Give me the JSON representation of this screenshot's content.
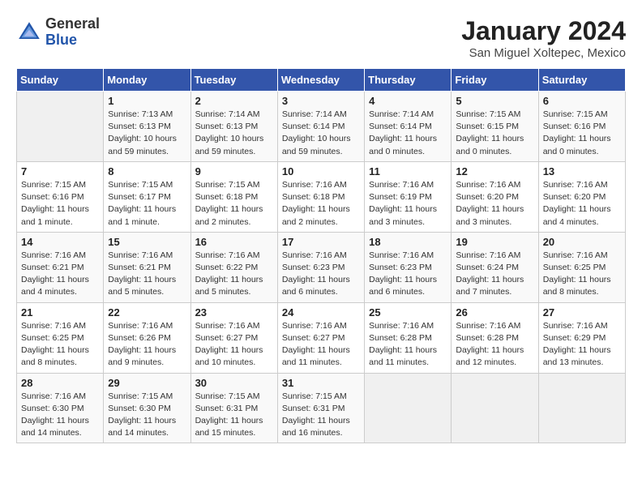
{
  "header": {
    "logo_line1": "General",
    "logo_line2": "Blue",
    "month_year": "January 2024",
    "location": "San Miguel Xoltepec, Mexico"
  },
  "days_of_week": [
    "Sunday",
    "Monday",
    "Tuesday",
    "Wednesday",
    "Thursday",
    "Friday",
    "Saturday"
  ],
  "weeks": [
    [
      {
        "day": "",
        "info": ""
      },
      {
        "day": "1",
        "info": "Sunrise: 7:13 AM\nSunset: 6:13 PM\nDaylight: 10 hours\nand 59 minutes."
      },
      {
        "day": "2",
        "info": "Sunrise: 7:14 AM\nSunset: 6:13 PM\nDaylight: 10 hours\nand 59 minutes."
      },
      {
        "day": "3",
        "info": "Sunrise: 7:14 AM\nSunset: 6:14 PM\nDaylight: 10 hours\nand 59 minutes."
      },
      {
        "day": "4",
        "info": "Sunrise: 7:14 AM\nSunset: 6:14 PM\nDaylight: 11 hours\nand 0 minutes."
      },
      {
        "day": "5",
        "info": "Sunrise: 7:15 AM\nSunset: 6:15 PM\nDaylight: 11 hours\nand 0 minutes."
      },
      {
        "day": "6",
        "info": "Sunrise: 7:15 AM\nSunset: 6:16 PM\nDaylight: 11 hours\nand 0 minutes."
      }
    ],
    [
      {
        "day": "7",
        "info": "Sunrise: 7:15 AM\nSunset: 6:16 PM\nDaylight: 11 hours\nand 1 minute."
      },
      {
        "day": "8",
        "info": "Sunrise: 7:15 AM\nSunset: 6:17 PM\nDaylight: 11 hours\nand 1 minute."
      },
      {
        "day": "9",
        "info": "Sunrise: 7:15 AM\nSunset: 6:18 PM\nDaylight: 11 hours\nand 2 minutes."
      },
      {
        "day": "10",
        "info": "Sunrise: 7:16 AM\nSunset: 6:18 PM\nDaylight: 11 hours\nand 2 minutes."
      },
      {
        "day": "11",
        "info": "Sunrise: 7:16 AM\nSunset: 6:19 PM\nDaylight: 11 hours\nand 3 minutes."
      },
      {
        "day": "12",
        "info": "Sunrise: 7:16 AM\nSunset: 6:20 PM\nDaylight: 11 hours\nand 3 minutes."
      },
      {
        "day": "13",
        "info": "Sunrise: 7:16 AM\nSunset: 6:20 PM\nDaylight: 11 hours\nand 4 minutes."
      }
    ],
    [
      {
        "day": "14",
        "info": "Sunrise: 7:16 AM\nSunset: 6:21 PM\nDaylight: 11 hours\nand 4 minutes."
      },
      {
        "day": "15",
        "info": "Sunrise: 7:16 AM\nSunset: 6:21 PM\nDaylight: 11 hours\nand 5 minutes."
      },
      {
        "day": "16",
        "info": "Sunrise: 7:16 AM\nSunset: 6:22 PM\nDaylight: 11 hours\nand 5 minutes."
      },
      {
        "day": "17",
        "info": "Sunrise: 7:16 AM\nSunset: 6:23 PM\nDaylight: 11 hours\nand 6 minutes."
      },
      {
        "day": "18",
        "info": "Sunrise: 7:16 AM\nSunset: 6:23 PM\nDaylight: 11 hours\nand 6 minutes."
      },
      {
        "day": "19",
        "info": "Sunrise: 7:16 AM\nSunset: 6:24 PM\nDaylight: 11 hours\nand 7 minutes."
      },
      {
        "day": "20",
        "info": "Sunrise: 7:16 AM\nSunset: 6:25 PM\nDaylight: 11 hours\nand 8 minutes."
      }
    ],
    [
      {
        "day": "21",
        "info": "Sunrise: 7:16 AM\nSunset: 6:25 PM\nDaylight: 11 hours\nand 8 minutes."
      },
      {
        "day": "22",
        "info": "Sunrise: 7:16 AM\nSunset: 6:26 PM\nDaylight: 11 hours\nand 9 minutes."
      },
      {
        "day": "23",
        "info": "Sunrise: 7:16 AM\nSunset: 6:27 PM\nDaylight: 11 hours\nand 10 minutes."
      },
      {
        "day": "24",
        "info": "Sunrise: 7:16 AM\nSunset: 6:27 PM\nDaylight: 11 hours\nand 11 minutes."
      },
      {
        "day": "25",
        "info": "Sunrise: 7:16 AM\nSunset: 6:28 PM\nDaylight: 11 hours\nand 11 minutes."
      },
      {
        "day": "26",
        "info": "Sunrise: 7:16 AM\nSunset: 6:28 PM\nDaylight: 11 hours\nand 12 minutes."
      },
      {
        "day": "27",
        "info": "Sunrise: 7:16 AM\nSunset: 6:29 PM\nDaylight: 11 hours\nand 13 minutes."
      }
    ],
    [
      {
        "day": "28",
        "info": "Sunrise: 7:16 AM\nSunset: 6:30 PM\nDaylight: 11 hours\nand 14 minutes."
      },
      {
        "day": "29",
        "info": "Sunrise: 7:15 AM\nSunset: 6:30 PM\nDaylight: 11 hours\nand 14 minutes."
      },
      {
        "day": "30",
        "info": "Sunrise: 7:15 AM\nSunset: 6:31 PM\nDaylight: 11 hours\nand 15 minutes."
      },
      {
        "day": "31",
        "info": "Sunrise: 7:15 AM\nSunset: 6:31 PM\nDaylight: 11 hours\nand 16 minutes."
      },
      {
        "day": "",
        "info": ""
      },
      {
        "day": "",
        "info": ""
      },
      {
        "day": "",
        "info": ""
      }
    ]
  ]
}
